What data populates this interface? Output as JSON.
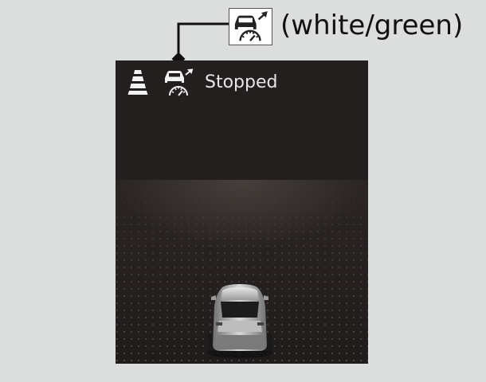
{
  "callout": {
    "icon": "acc-car-speedometer-icon",
    "label": "(white/green)"
  },
  "display": {
    "lane_icon": "lane-keeping-icon",
    "acc_icon": "acc-car-speedometer-icon",
    "status": "Stopped",
    "vehicle": "own-vehicle-icon"
  },
  "colors": {
    "page_background": "#dcdddd",
    "display_background": "#231f1e",
    "status_text": "#e6e6e6",
    "icon_white": "#f2f2f2"
  }
}
